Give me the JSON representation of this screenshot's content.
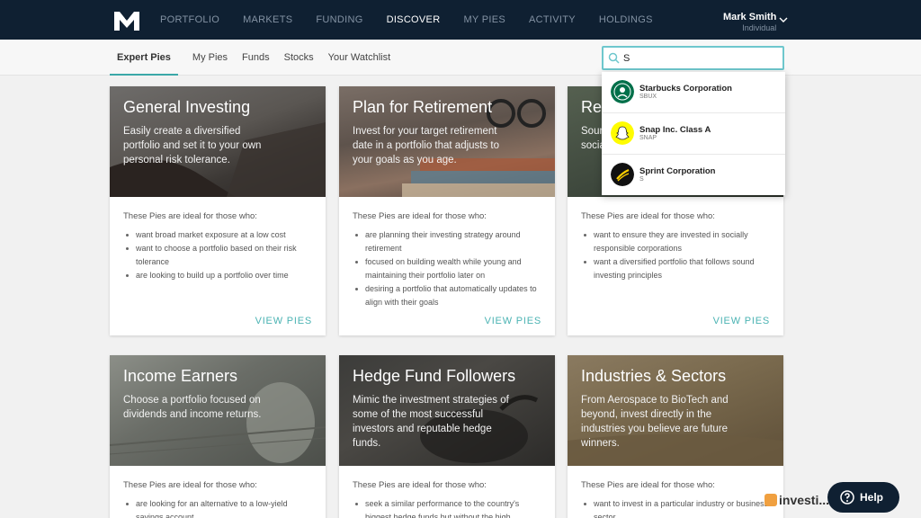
{
  "nav": {
    "items": [
      {
        "label": "PORTFOLIO",
        "active": false
      },
      {
        "label": "MARKETS",
        "active": false
      },
      {
        "label": "FUNDING",
        "active": false
      },
      {
        "label": "DISCOVER",
        "active": true
      },
      {
        "label": "MY PIES",
        "active": false
      },
      {
        "label": "ACTIVITY",
        "active": false
      },
      {
        "label": "HOLDINGS",
        "active": false
      }
    ],
    "user_name": "Mark Smith",
    "user_account": "Individual"
  },
  "subnav": {
    "tabs": [
      {
        "label": "Expert Pies",
        "active": true
      },
      {
        "label": "My Pies",
        "active": false
      },
      {
        "label": "Funds",
        "active": false
      },
      {
        "label": "Stocks",
        "active": false
      },
      {
        "label": "Your Watchlist",
        "active": false
      }
    ]
  },
  "search": {
    "value": "S",
    "results": [
      {
        "name": "Starbucks Corporation",
        "symbol": "SBUX",
        "icon": "starbucks-logo"
      },
      {
        "name": "Snap Inc. Class A",
        "symbol": "SNAP",
        "icon": "snapchat-logo"
      },
      {
        "name": "Sprint Corporation",
        "symbol": "S",
        "icon": "sprint-logo"
      }
    ]
  },
  "cards": [
    {
      "title": "General Investing",
      "description": "Easily create a diversified portfolio and set it to your own personal risk tolerance.",
      "intro": "These Pies are ideal for those who:",
      "bullets": [
        "want broad market exposure at a low cost",
        "want to choose a portfolio based on their risk tolerance",
        "are looking to build up a portfolio over time"
      ],
      "cta": "VIEW PIES"
    },
    {
      "title": "Plan for Retirement",
      "description": "Invest for your target retirement date in a portfolio that adjusts to your goals as you age.",
      "intro": "These Pies are ideal for those who:",
      "bullets": [
        "are planning their investing strategy around retirement",
        "focused on building wealth while young and maintaining their portfolio later on",
        "desiring a portfolio that automatically updates to align with their goals"
      ],
      "cta": "VIEW PIES"
    },
    {
      "title": "Res",
      "description": "Sour social",
      "intro": "These Pies are ideal for those who:",
      "bullets": [
        "want to ensure they are invested in socially responsible corporations",
        "want a diversified portfolio that follows sound investing principles"
      ],
      "cta": "VIEW PIES"
    },
    {
      "title": "Income Earners",
      "description": "Choose a portfolio focused on dividends and income returns.",
      "intro": "These Pies are ideal for those who:",
      "bullets": [
        "are looking for an alternative to a low-yield savings account"
      ],
      "cta": ""
    },
    {
      "title": "Hedge Fund Followers",
      "description": "Mimic the investment strategies of some of the most successful investors and reputable hedge funds.",
      "intro": "These Pies are ideal for those who:",
      "bullets": [
        "seek a similar performance to the country's biggest hedge funds but without the high"
      ],
      "cta": ""
    },
    {
      "title": "Industries & Sectors",
      "description": "From Aerospace to BioTech and beyond, invest directly in the industries you believe are future winners.",
      "intro": "These Pies are ideal for those who:",
      "bullets": [
        "want to invest in a particular industry or business sector"
      ],
      "cta": ""
    }
  ],
  "help": {
    "label": "Help"
  },
  "watermark": "investi...com",
  "colors": {
    "nav_bg": "#0f2032",
    "accent": "#4bb3b3",
    "search_border": "#6ec7cd"
  }
}
